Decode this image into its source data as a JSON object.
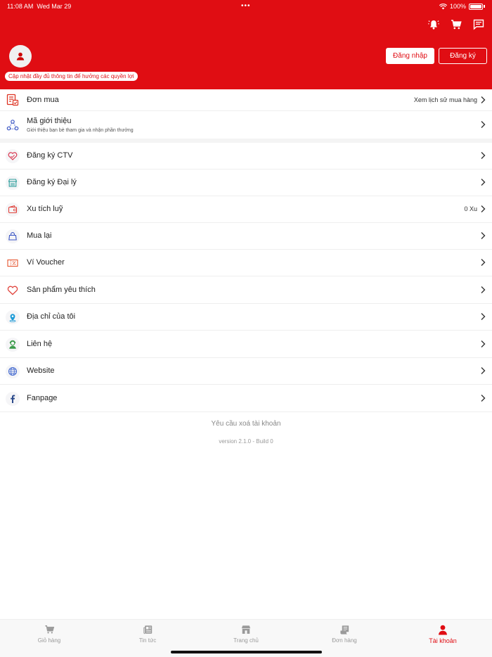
{
  "status_bar": {
    "time": "11:08 AM",
    "date": "Wed Mar 29",
    "battery": "100%"
  },
  "header": {
    "update_note": "Cập nhật đầy đủ thông tin để hưởng các quyền lợi",
    "login_label": "Đăng nhập",
    "register_label": "Đăng ký",
    "icons": [
      "bell-alert-icon",
      "cart-icon",
      "chat-icon"
    ],
    "brand_color": "#e00d13"
  },
  "orders_row": {
    "label": "Đơn mua",
    "right_text": "Xem lịch sử mua hàng",
    "icon": "order-icon"
  },
  "referral_row": {
    "label": "Mã giới thiệu",
    "sub": "Giới thiệu bạn bè tham gia và nhận phần thưởng",
    "icon": "referral-icon"
  },
  "menu": [
    {
      "label": "Đăng ký CTV",
      "right": "",
      "icon": "ctv-heart-icon"
    },
    {
      "label": "Đăng ký Đại lý",
      "right": "",
      "icon": "store-icon"
    },
    {
      "label": "Xu tích luỹ",
      "right": "0 Xu",
      "icon": "wallet-icon"
    },
    {
      "label": "Mua lại",
      "right": "",
      "icon": "bag-icon"
    },
    {
      "label": "Ví Voucher",
      "right": "",
      "icon": "voucher-icon"
    },
    {
      "label": "Sản phẩm yêu thích",
      "right": "",
      "icon": "heart-icon"
    },
    {
      "label": "Địa chỉ của tôi",
      "right": "",
      "icon": "location-icon"
    },
    {
      "label": "Liên hệ",
      "right": "",
      "icon": "contact-icon"
    },
    {
      "label": "Website",
      "right": "",
      "icon": "globe-icon"
    },
    {
      "label": "Fanpage",
      "right": "",
      "icon": "facebook-icon"
    }
  ],
  "footer": {
    "delete_account": "Yêu cầu xoá tài khoản",
    "version": "version 2.1.0 - Build 0"
  },
  "tabs": [
    {
      "label": "Giỏ hàng",
      "icon": "cart-icon",
      "active": false
    },
    {
      "label": "Tin tức",
      "icon": "news-icon",
      "active": false
    },
    {
      "label": "Trang chủ",
      "icon": "home-store-icon",
      "active": false
    },
    {
      "label": "Đơn hàng",
      "icon": "orders-icon",
      "active": false
    },
    {
      "label": "Tài khoản",
      "icon": "account-icon",
      "active": true
    }
  ]
}
